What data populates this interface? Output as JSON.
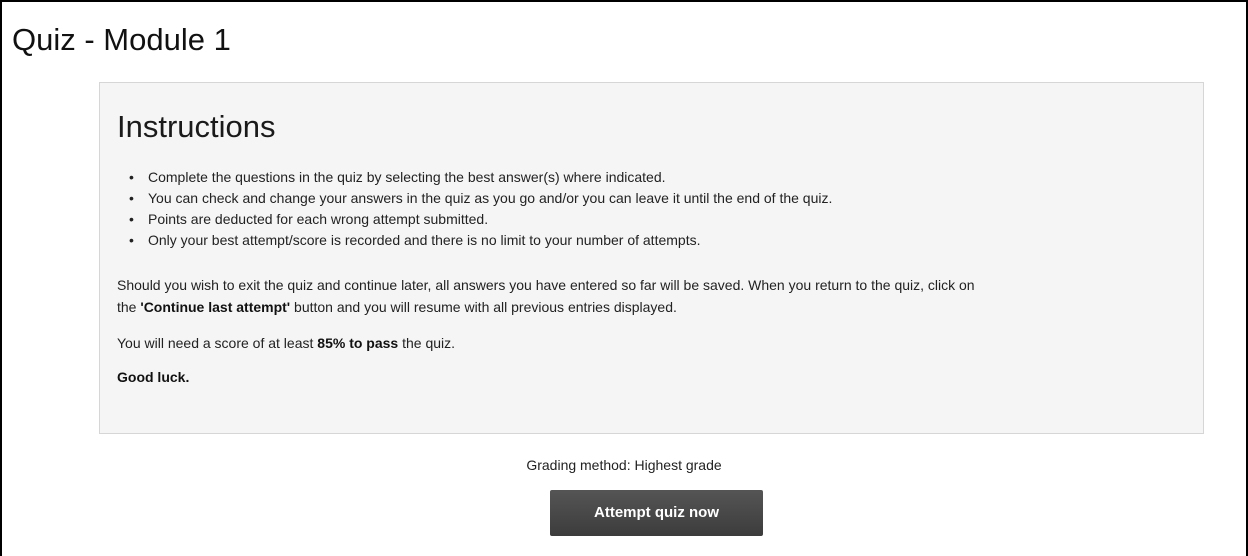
{
  "page": {
    "title": "Quiz - Module 1"
  },
  "instructions": {
    "heading": "Instructions",
    "bullet_glyph": "•",
    "bullets": [
      "Complete the questions in the quiz by selecting the best answer(s) where indicated.",
      "You can check and change your answers in the quiz as you go and/or you can leave it until the end of the quiz.",
      "Points are deducted for each wrong attempt submitted.",
      "Only your best attempt/score is recorded and there is no limit to your number of attempts."
    ],
    "exit_paragraph": {
      "line1": "Should you wish to exit the quiz and continue later, all answers you have entered so far will be saved. When you return to the quiz, click on",
      "line2_before": "the ",
      "line2_bold": "'Continue last attempt'",
      "line2_after": " button and you will resume with all previous entries displayed."
    },
    "score_paragraph": {
      "before": "You will need a score of at least ",
      "bold": "85% to pass",
      "after": " the quiz."
    },
    "closing": "Good luck."
  },
  "quiz": {
    "grading_method": "Grading method: Highest grade",
    "attempt_button_label": "Attempt quiz now"
  },
  "colors": {
    "panel_background": "#f5f5f5",
    "panel_border": "#d6d6d6",
    "button_background": "#444444",
    "button_text": "#ffffff"
  }
}
